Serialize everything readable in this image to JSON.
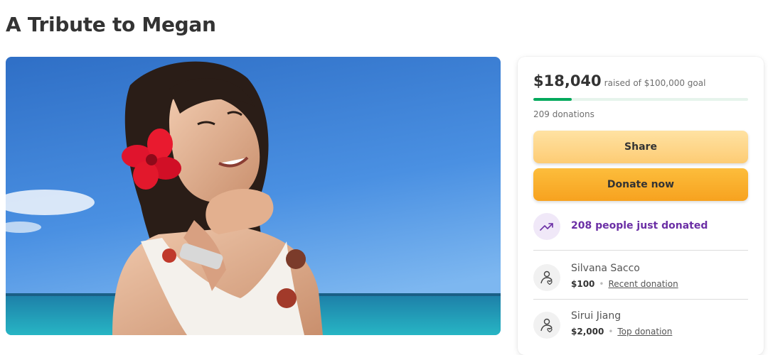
{
  "page": {
    "title": "A Tribute to Megan"
  },
  "fundraiser": {
    "raised": "$18,040",
    "goal_text": "raised of $100,000 goal",
    "progress_fraction": 0.18,
    "donations_count": "209 donations",
    "share_label": "Share",
    "donate_label": "Donate now",
    "recent_activity": "208 people just donated",
    "donors": [
      {
        "name": "Silvana Sacco",
        "amount": "$100",
        "tag": "Recent donation"
      },
      {
        "name": "Sirui Jiang",
        "amount": "$2,000",
        "tag": "Top donation"
      }
    ]
  },
  "icons": {
    "trend": "trending-up-icon",
    "donor": "heart-hand-icon"
  },
  "colors": {
    "accent_green": "#02a95c",
    "share_button": "#fdcc74",
    "donate_button": "#f7a21f",
    "activity_purple": "#6b2fa5"
  }
}
